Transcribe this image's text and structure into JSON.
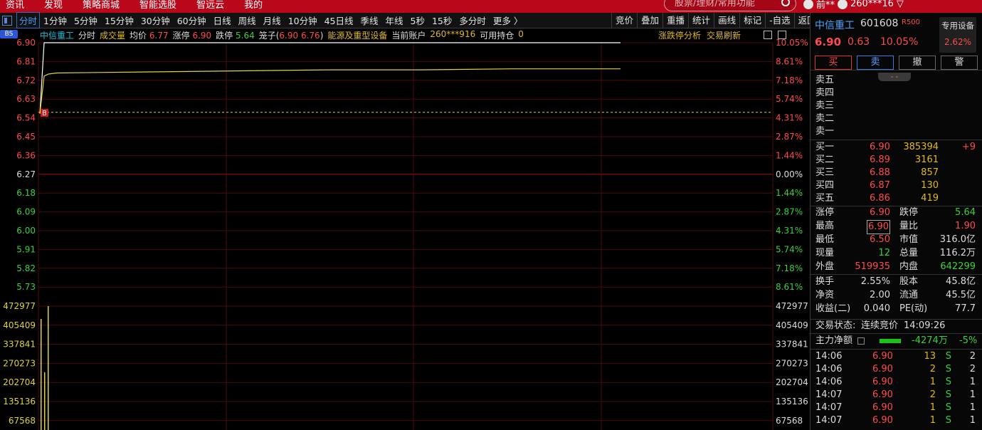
{
  "topbar": {
    "menu": [
      "资讯",
      "发现",
      "策略商城",
      "智能选股",
      "智远云",
      "我的"
    ],
    "search_placeholder": "股票/理财/常用功能",
    "user": "前**",
    "account": "260***16"
  },
  "tabs": [
    "分时",
    "1分钟",
    "5分钟",
    "15分钟",
    "30分钟",
    "60分钟",
    "日线",
    "周线",
    "月线",
    "10分钟",
    "45日线",
    "季线",
    "年线",
    "5秒",
    "15秒",
    "多分时",
    "更多 〉"
  ],
  "right_buttons": [
    "竞价",
    "叠加",
    "重播",
    "统计",
    "画线",
    "标记",
    "-自选",
    "返回"
  ],
  "infobar": {
    "bs_badge": "BS",
    "stock_name": "中信重工",
    "mode": "分时",
    "volume_label": "成交量",
    "avg_label": "均价",
    "avg_value": "6.77",
    "limit_up_label": "涨停",
    "limit_up_value": "6.90",
    "limit_down_label": "跌停",
    "limit_down_value": "5.64",
    "cage_label": "笼子(",
    "cage_low": "6.90",
    "cage_high": "6.76",
    "cage_end": ")",
    "sector": "能源及重型设备",
    "account_label": "当前账户",
    "account": "260***916",
    "holding_label": "可用持仓",
    "holding_value": "0",
    "analysis_link": "涨跌停分析",
    "refresh_link": "交易刷新"
  },
  "price_axis": {
    "left": [
      "6.90",
      "6.81",
      "6.72",
      "6.63",
      "6.54",
      "6.45",
      "6.36",
      "6.27",
      "6.18",
      "6.09",
      "6.00",
      "5.91",
      "5.82",
      "5.73"
    ],
    "right": [
      "10.05%",
      "8.61%",
      "7.18%",
      "5.74%",
      "4.31%",
      "2.87%",
      "1.44%",
      "0.00%",
      "1.44%",
      "2.87%",
      "4.31%",
      "5.74%",
      "7.18%",
      "8.61%"
    ],
    "prev_close": 6.27
  },
  "volume_axis": [
    "472977",
    "405409",
    "337841",
    "270273",
    "202704",
    "135136",
    "67568"
  ],
  "buy_marker": "B",
  "colors": {
    "up": "#ff4b4b",
    "down": "#3bd13b",
    "neutral": "#dddddd",
    "avg_line": "#e0d23a",
    "price_line": "#ffffff",
    "accent": "#b8081a"
  },
  "chart_data": {
    "type": "line",
    "series": [
      {
        "values": [
          6.56,
          6.9,
          6.9,
          6.9,
          6.9,
          6.9,
          6.9,
          6.9,
          6.9,
          6.9,
          6.9
        ]
      },
      {
        "values": [
          6.56,
          6.74,
          6.75,
          6.755,
          6.76,
          6.765,
          6.77,
          6.77,
          6.775,
          6.775,
          6.775
        ]
      }
    ],
    "ylim": [
      5.64,
      6.9
    ],
    "volume_ylim": [
      0,
      472977
    ],
    "volumes": [
      385394,
      200000,
      430000
    ]
  },
  "sidebar": {
    "name": "中信重工",
    "code": "601608",
    "r500": "R500",
    "price": "6.90",
    "change": "0.63",
    "pct": "10.05%",
    "device_label": "专用设备",
    "device_pct": "2.62%",
    "actions": [
      "买",
      "卖",
      "撤",
      "警"
    ],
    "asks": [
      "卖五",
      "卖四",
      "卖三",
      "卖二",
      "卖一"
    ],
    "bids": [
      {
        "label": "买一",
        "price": "6.90",
        "vol": "385394",
        "chg": "+9"
      },
      {
        "label": "买二",
        "price": "6.89",
        "vol": "3161",
        "chg": ""
      },
      {
        "label": "买三",
        "price": "6.88",
        "vol": "857",
        "chg": ""
      },
      {
        "label": "买四",
        "price": "6.87",
        "vol": "130",
        "chg": ""
      },
      {
        "label": "买五",
        "price": "6.86",
        "vol": "419",
        "chg": ""
      }
    ],
    "stats": [
      {
        "l1": "涨停",
        "v1": "6.90",
        "c1": "rd",
        "l2": "跌停",
        "v2": "5.64",
        "c2": "gr"
      },
      {
        "l1": "最高",
        "v1": "6.90",
        "c1": "rd",
        "l2": "量比",
        "v2": "1.90",
        "c2": "rd"
      },
      {
        "l1": "最低",
        "v1": "6.50",
        "c1": "rd",
        "l2": "市值",
        "v2": "316.0亿",
        "c2": "wh"
      },
      {
        "l1": "现量",
        "v1": "12",
        "c1": "gr",
        "l2": "总量",
        "v2": "116.2万",
        "c2": "wh"
      },
      {
        "l1": "外盘",
        "v1": "519935",
        "c1": "rd",
        "l2": "内盘",
        "v2": "642299",
        "c2": "gr"
      }
    ],
    "stats2": [
      {
        "l1": "换手",
        "v1": "2.55%",
        "l2": "股本",
        "v2": "45.8亿"
      },
      {
        "l1": "净资",
        "v1": "2.00",
        "l2": "流通",
        "v2": "45.5亿"
      },
      {
        "l1": "收益(二)",
        "v1": "0.040",
        "l2": "PE(动)",
        "v2": "77.7"
      }
    ],
    "status_label": "交易状态:",
    "status": "连续竞价",
    "time": "14:09:26",
    "flow_label": "主力净额",
    "flow_value": "-4274万",
    "flow_pct": "-5%",
    "ticks": [
      {
        "t": "14:06",
        "p": "6.90",
        "v": "13",
        "s": "S",
        "n": "2"
      },
      {
        "t": "14:06",
        "p": "6.90",
        "v": "2",
        "s": "S",
        "n": "2"
      },
      {
        "t": "14:06",
        "p": "6.90",
        "v": "1",
        "s": "S",
        "n": "1"
      },
      {
        "t": "14:07",
        "p": "6.90",
        "v": "2",
        "s": "S",
        "n": "1"
      },
      {
        "t": "14:07",
        "p": "6.90",
        "v": "1",
        "s": "S",
        "n": "1"
      },
      {
        "t": "14:07",
        "p": "6.90",
        "v": "1",
        "s": "S",
        "n": "1"
      }
    ]
  }
}
